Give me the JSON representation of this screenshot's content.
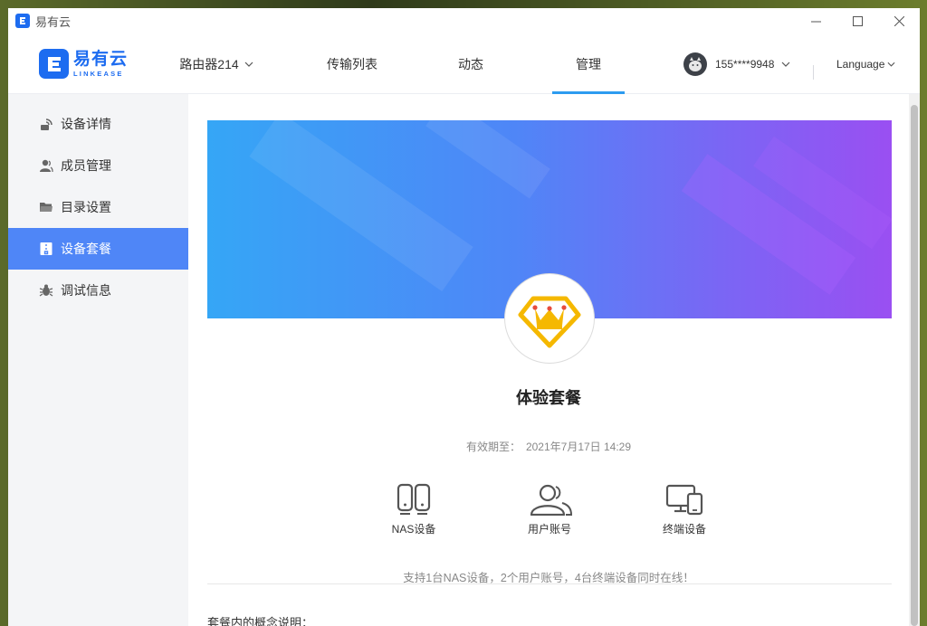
{
  "window": {
    "title": "易有云"
  },
  "brand": {
    "name_cn": "易有云",
    "name_en": "LINKEASE"
  },
  "nav": {
    "items": [
      {
        "label": "路由器214"
      },
      {
        "label": "传输列表"
      },
      {
        "label": "动态"
      },
      {
        "label": "管理"
      }
    ],
    "active": "管理"
  },
  "user": {
    "name": "155****9948"
  },
  "language": {
    "label": "Language"
  },
  "sidebar": {
    "items": [
      {
        "label": "设备详情",
        "icon": "router-icon"
      },
      {
        "label": "成员管理",
        "icon": "user-icon"
      },
      {
        "label": "目录设置",
        "icon": "folder-icon"
      },
      {
        "label": "设备套餐",
        "icon": "package-icon"
      },
      {
        "label": "调试信息",
        "icon": "bug-icon"
      }
    ],
    "active": "设备套餐"
  },
  "plan": {
    "name": "体验套餐",
    "validity_label": "有效期至：",
    "validity_value": "2021年7月17日 14:29",
    "features": [
      {
        "label": "NAS设备",
        "icon": "nas-icon"
      },
      {
        "label": "用户账号",
        "icon": "users-icon"
      },
      {
        "label": "终端设备",
        "icon": "devices-icon"
      }
    ],
    "support_text": "支持1台NAS设备，2个用户账号，4台终端设备同时在线！",
    "concept_title": "套餐内的概念说明："
  },
  "colors": {
    "accent": "#4f86f7",
    "brand": "#1d6cf0",
    "tab_underline": "#2d9cf0",
    "badge_gold": "#f5b800"
  }
}
